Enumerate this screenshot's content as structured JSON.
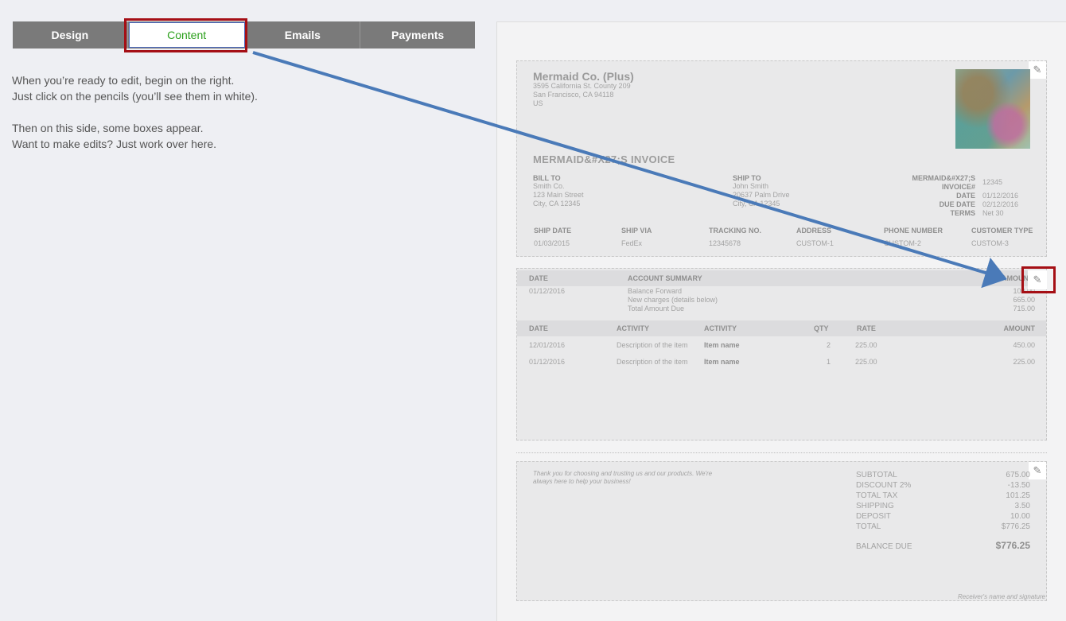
{
  "tabs": [
    {
      "label": "Design"
    },
    {
      "label": "Content"
    },
    {
      "label": "Emails"
    },
    {
      "label": "Payments"
    }
  ],
  "instructions": {
    "line1": "When you’re ready to edit, begin on the right.",
    "line2": "Just click on the pencils (you’ll see them in white).",
    "line3": "Then on this side, some boxes appear.",
    "line4": "Want to make edits? Just work over here."
  },
  "invoice": {
    "company": {
      "name": "Mermaid Co. (Plus)",
      "address1": "3595 California St. County 209",
      "address2": "San Francisco, CA 94118",
      "country": "US"
    },
    "title": "MERMAID&#X27;S INVOICE",
    "bill_to": {
      "label": "BILL TO",
      "line1": "Smith Co.",
      "line2": "123 Main Street",
      "line3": "City, CA 12345"
    },
    "ship_to": {
      "label": "SHIP TO",
      "line1": "John Smith",
      "line2": "20637 Palm Drive",
      "line3": "City, CA 12345"
    },
    "meta": {
      "invoice_label1": "MERMAID&#X27;S",
      "invoice_label2": "INVOICE#",
      "invoice_no": "12345",
      "date_label": "DATE",
      "date": "01/12/2016",
      "due_label": "DUE DATE",
      "due": "02/12/2016",
      "terms_label": "TERMS",
      "terms": "Net 30"
    },
    "shipping_headers": [
      "SHIP DATE",
      "SHIP VIA",
      "TRACKING NO.",
      "ADDRESS",
      "PHONE NUMBER",
      "CUSTOMER TYPE"
    ],
    "shipping_values": [
      "01/03/2015",
      "FedEx",
      "12345678",
      "CUSTOM-1",
      "CUSTOM-2",
      "CUSTOM-3"
    ],
    "summary": {
      "headers": {
        "date": "DATE",
        "account": "ACCOUNT SUMMARY",
        "amount": "AMOUNT"
      },
      "date": "01/12/2016",
      "rows": [
        {
          "label": "Balance Forward",
          "value": "100.00"
        },
        {
          "label": "New charges (details below)",
          "value": "665.00"
        },
        {
          "label": "Total Amount Due",
          "value": "715.00"
        }
      ]
    },
    "items": {
      "headers": {
        "date": "DATE",
        "activity": "ACTIVITY",
        "activity2": "ACTIVITY",
        "qty": "QTY",
        "rate": "RATE",
        "amount": "AMOUNT"
      },
      "rows": [
        {
          "date": "12/01/2016",
          "desc": "Description of the item",
          "name": "Item name",
          "qty": "2",
          "rate": "225.00",
          "amount": "450.00"
        },
        {
          "date": "01/12/2016",
          "desc": "Description of the item",
          "name": "Item name",
          "qty": "1",
          "rate": "225.00",
          "amount": "225.00"
        }
      ]
    },
    "footer": {
      "message1": "Thank you for choosing and trusting us and our products. We're",
      "message2": "always here to help your business!",
      "totals": [
        {
          "label": "SUBTOTAL",
          "value": "675.00"
        },
        {
          "label": "DISCOUNT 2%",
          "value": "-13.50"
        },
        {
          "label": "TOTAL TAX",
          "value": "101.25"
        },
        {
          "label": "SHIPPING",
          "value": "3.50"
        },
        {
          "label": "DEPOSIT",
          "value": "10.00"
        },
        {
          "label": "TOTAL",
          "value": "$776.25"
        }
      ],
      "balance_label": "BALANCE DUE",
      "balance_value": "$776.25",
      "signature": "Receiver's name and signature"
    }
  },
  "colors": {
    "accent_green": "#2ca01c",
    "highlight_red": "#a50f15",
    "arrow_blue": "#4a7ab8",
    "tab_gray": "#7a7a7a"
  },
  "icons": {
    "pencil": "pencil-icon",
    "arrow": "arrow-annotation"
  }
}
